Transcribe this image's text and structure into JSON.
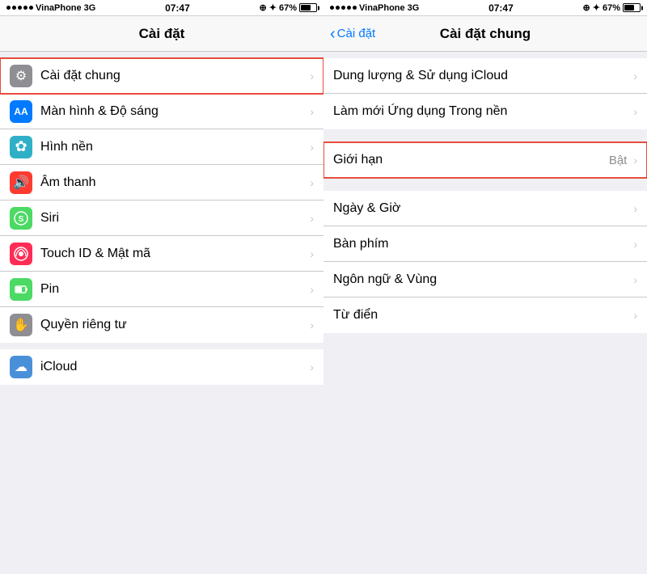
{
  "left_panel": {
    "status": {
      "carrier": "VinaPhone",
      "network": "3G",
      "time": "07:47",
      "battery": "67%"
    },
    "nav": {
      "title": "Cài đặt"
    },
    "items": [
      {
        "id": "cai-dat-chung",
        "label": "Cài đặt chung",
        "icon": "⚙",
        "icon_class": "icon-gear",
        "highlighted": true
      },
      {
        "id": "man-hinh",
        "label": "Màn hình & Độ sáng",
        "icon": "AA",
        "icon_class": "icon-display",
        "highlighted": false
      },
      {
        "id": "hinh-nen",
        "label": "Hình nền",
        "icon": "✿",
        "icon_class": "icon-wallpaper",
        "highlighted": false
      },
      {
        "id": "am-thanh",
        "label": "Âm thanh",
        "icon": "🔊",
        "icon_class": "icon-sound",
        "highlighted": false
      },
      {
        "id": "siri",
        "label": "Siri",
        "icon": "S",
        "icon_class": "icon-siri",
        "highlighted": false
      },
      {
        "id": "touch-id",
        "label": "Touch ID & Mật mã",
        "icon": "⊙",
        "icon_class": "icon-touchid",
        "highlighted": false
      },
      {
        "id": "pin",
        "label": "Pin",
        "icon": "🔋",
        "icon_class": "icon-battery",
        "highlighted": false
      },
      {
        "id": "quyen-rieng-tu",
        "label": "Quyền riêng tư",
        "icon": "✋",
        "icon_class": "icon-privacy",
        "highlighted": false
      },
      {
        "id": "icloud",
        "label": "iCloud",
        "icon": "☁",
        "icon_class": "icon-icloud",
        "highlighted": false
      }
    ]
  },
  "right_panel": {
    "status": {
      "carrier": "VinaPhone",
      "network": "3G",
      "time": "07:47",
      "battery": "67%"
    },
    "nav": {
      "back_label": "Cài đặt",
      "title": "Cài đặt chung"
    },
    "groups": [
      {
        "items": [
          {
            "id": "dung-luong",
            "label": "Dung lượng & Sử dụng iCloud",
            "value": "",
            "highlighted": false
          },
          {
            "id": "lam-moi",
            "label": "Làm mới Ứng dụng Trong nền",
            "value": "",
            "highlighted": false
          }
        ]
      },
      {
        "items": [
          {
            "id": "gioi-han",
            "label": "Giới hạn",
            "value": "Bật",
            "highlighted": true
          }
        ]
      },
      {
        "items": [
          {
            "id": "ngay-gio",
            "label": "Ngày & Giờ",
            "value": "",
            "highlighted": false
          },
          {
            "id": "ban-phim",
            "label": "Bàn phím",
            "value": "",
            "highlighted": false
          },
          {
            "id": "ngon-ngu",
            "label": "Ngôn ngữ & Vùng",
            "value": "",
            "highlighted": false
          },
          {
            "id": "tu-dien",
            "label": "Từ điển",
            "value": "",
            "highlighted": false
          }
        ]
      }
    ]
  }
}
